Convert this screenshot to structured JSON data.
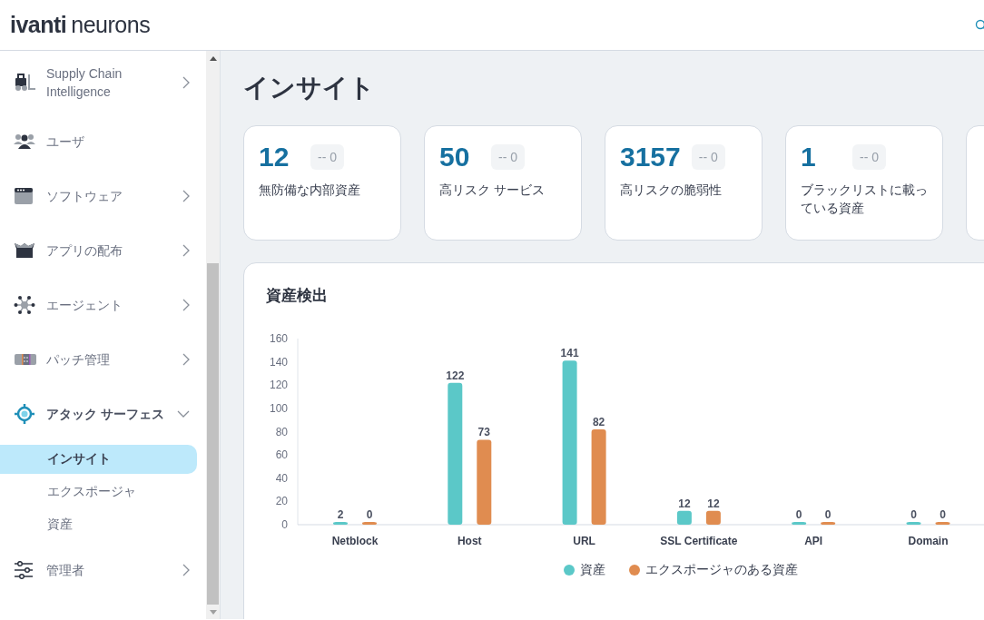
{
  "header": {
    "logo_brand": "ivanti",
    "logo_product": "neurons"
  },
  "sidebar": {
    "items": [
      {
        "label": "Supply Chain Intelligence",
        "expanded": false
      },
      {
        "label": "ユーザ"
      },
      {
        "label": "ソフトウェア",
        "expanded": false
      },
      {
        "label": "アプリの配布",
        "expanded": false
      },
      {
        "label": "エージェント",
        "expanded": false
      },
      {
        "label": "パッチ管理",
        "expanded": false
      },
      {
        "label": "アタック サーフェス",
        "expanded": true,
        "children": [
          {
            "label": "インサイト",
            "selected": true
          },
          {
            "label": "エクスポージャ",
            "selected": false
          },
          {
            "label": "資産",
            "selected": false
          }
        ]
      },
      {
        "label": "管理者",
        "expanded": false
      }
    ]
  },
  "page_title": "インサイト",
  "cards": [
    {
      "value": "12",
      "delta": "-- 0",
      "label": "無防備な内部資産"
    },
    {
      "value": "50",
      "delta": "-- 0",
      "label": "高リスク サービス"
    },
    {
      "value": "3157",
      "delta": "-- 0",
      "label": "高リスクの脆弱性"
    },
    {
      "value": "1",
      "delta": "-- 0",
      "label": "ブラックリストに載っている資産"
    }
  ],
  "asset_discovery": {
    "title": "資産検出",
    "chart_data": {
      "type": "bar",
      "categories": [
        "Netblock",
        "Host",
        "URL",
        "SSL Certificate",
        "API",
        "Domain"
      ],
      "series": [
        {
          "name": "資産",
          "color": "#5bc8c8",
          "values": [
            2,
            122,
            141,
            12,
            0,
            0
          ]
        },
        {
          "name": "エクスポージャのある資産",
          "color": "#e08c50",
          "values": [
            0,
            73,
            82,
            12,
            0,
            0
          ]
        }
      ],
      "ylim": [
        0,
        160
      ],
      "yticks": [
        0,
        20,
        40,
        60,
        80,
        100,
        120,
        140,
        160
      ],
      "data_labels": true
    }
  }
}
